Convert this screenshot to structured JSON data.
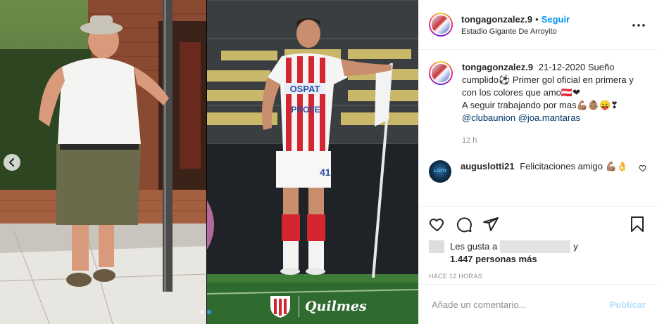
{
  "post": {
    "username": "tongagonzalez.9",
    "separator": "•",
    "follow_label": "Seguir",
    "location": "Estadio Gigante De Arroyito",
    "more_icon": "more-horizontal-icon"
  },
  "caption": {
    "username": "tongagonzalez.9",
    "text": "21-12-2020 Sueño cumplido⚽ Primer gol oficial en primera y con los colores que amo🇦🇹❤",
    "text2": "A seguir trabajando por mas💪🏽👶🏽😛❣",
    "mentions": [
      "@clubaunion",
      "@joa.mantaras"
    ],
    "time": "12 h"
  },
  "comments": [
    {
      "username": "auguslotti21",
      "text": "Felicitaciones amigo 💪🏽👌",
      "avatar_text": "LOTTI"
    }
  ],
  "actions": {
    "like_icon": "heart-icon",
    "comment_icon": "comment-icon",
    "share_icon": "share-icon",
    "save_icon": "bookmark-icon"
  },
  "likes": {
    "prefix": "Les gusta a",
    "conjunction": "y",
    "count_text": "1.447 personas más"
  },
  "posted": "HACE 12 HORAS",
  "add_comment": {
    "placeholder": "Añade un comentario...",
    "publish_label": "Publicar"
  },
  "media": {
    "watermark_text": "Quilmes",
    "slides": 2,
    "active_slide": 2
  }
}
